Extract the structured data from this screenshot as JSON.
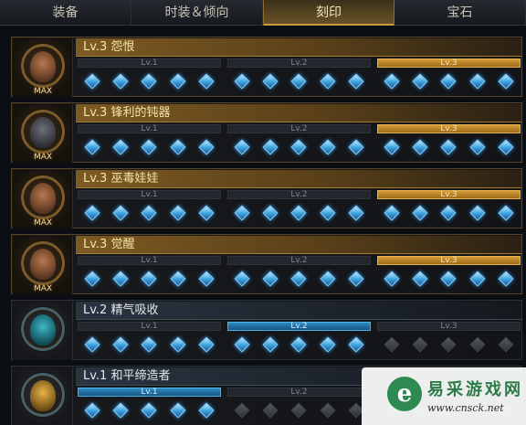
{
  "tabs": [
    {
      "label": "装备"
    },
    {
      "label": "时装＆倾向"
    },
    {
      "label": "刻印"
    },
    {
      "label": "宝石"
    }
  ],
  "active_tab": "刻印",
  "colors": {
    "gold": "#d39b32",
    "blue": "#2e89c4",
    "gem": "#3aa0e0",
    "off": "#2e3136"
  },
  "engravings": [
    {
      "title": "Lv.3 怨恨",
      "badge": "MAX",
      "levels": [
        "Lv.1",
        "Lv.2",
        "Lv.3"
      ],
      "level": 3,
      "gems": [
        5,
        5,
        5
      ],
      "icon": "grudge-icon"
    },
    {
      "title": "Lv.3 锋利的钝器",
      "badge": "MAX",
      "levels": [
        "Lv.1",
        "Lv.2",
        "Lv.3"
      ],
      "level": 3,
      "gems": [
        5,
        5,
        5
      ],
      "icon": "blunt-weapon-icon"
    },
    {
      "title": "Lv.3 巫毒娃娃",
      "badge": "MAX",
      "levels": [
        "Lv.1",
        "Lv.2",
        "Lv.3"
      ],
      "level": 3,
      "gems": [
        5,
        5,
        5
      ],
      "icon": "voodoo-doll-icon"
    },
    {
      "title": "Lv.3 觉醒",
      "badge": "MAX",
      "levels": [
        "Lv.1",
        "Lv.2",
        "Lv.3"
      ],
      "level": 3,
      "gems": [
        5,
        5,
        5
      ],
      "icon": "awakening-icon"
    },
    {
      "title": "Lv.2 精气吸收",
      "badge": "",
      "levels": [
        "Lv.1",
        "Lv.2",
        "Lv.3"
      ],
      "level": 2,
      "gems": [
        5,
        5,
        0
      ],
      "icon": "spirit-absorption-icon"
    },
    {
      "title": "Lv.1 和平缔造者",
      "badge": "",
      "levels": [
        "Lv.1",
        "Lv.2",
        "Lv.3"
      ],
      "level": 1,
      "gems": [
        5,
        0,
        0
      ],
      "icon": "peacemaker-icon"
    }
  ],
  "watermark": {
    "logo_glyph": "e",
    "name": "易采游戏网",
    "url": "www.cnsck.net"
  }
}
